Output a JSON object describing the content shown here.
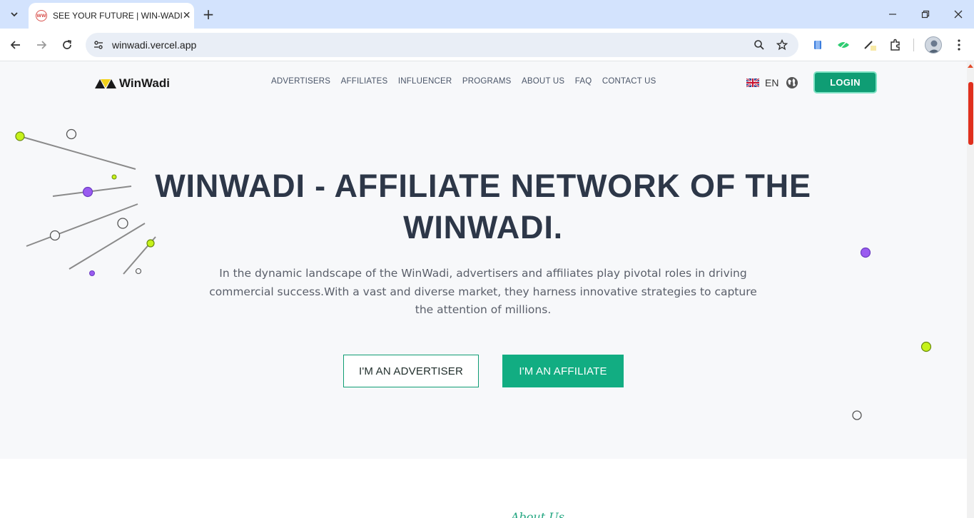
{
  "browser": {
    "tab_title": "SEE YOUR FUTURE | WIN-WADI",
    "favicon_text": "WW",
    "url": "winwadi.vercel.app"
  },
  "site": {
    "logo_text": "WinWadi",
    "nav": [
      "ADVERTISERS",
      "AFFILIATES",
      "INFLUENCER",
      "PROGRAMS",
      "ABOUT US",
      "FAQ",
      "CONTACT US"
    ],
    "language": "EN",
    "login_label": "LOGIN"
  },
  "hero": {
    "title_line1": "WINWADI - AFFILIATE NETWORK OF THE",
    "title_line2": "WINWADI.",
    "subtitle": "In the dynamic landscape of the WinWadi, advertisers and affiliates play pivotal roles in driving commercial success.With a vast and diverse market, they harness innovative strategies to capture the attention of millions.",
    "advertiser_button": "I'M AN ADVERTISER",
    "affiliate_button": "I'M AN AFFILIATE"
  },
  "next_section": {
    "script_heading": "About Us"
  },
  "colors": {
    "accent": "#12ad82",
    "title": "#2d3748",
    "lime": "#c6f21a",
    "purple": "#9a5bf0"
  }
}
